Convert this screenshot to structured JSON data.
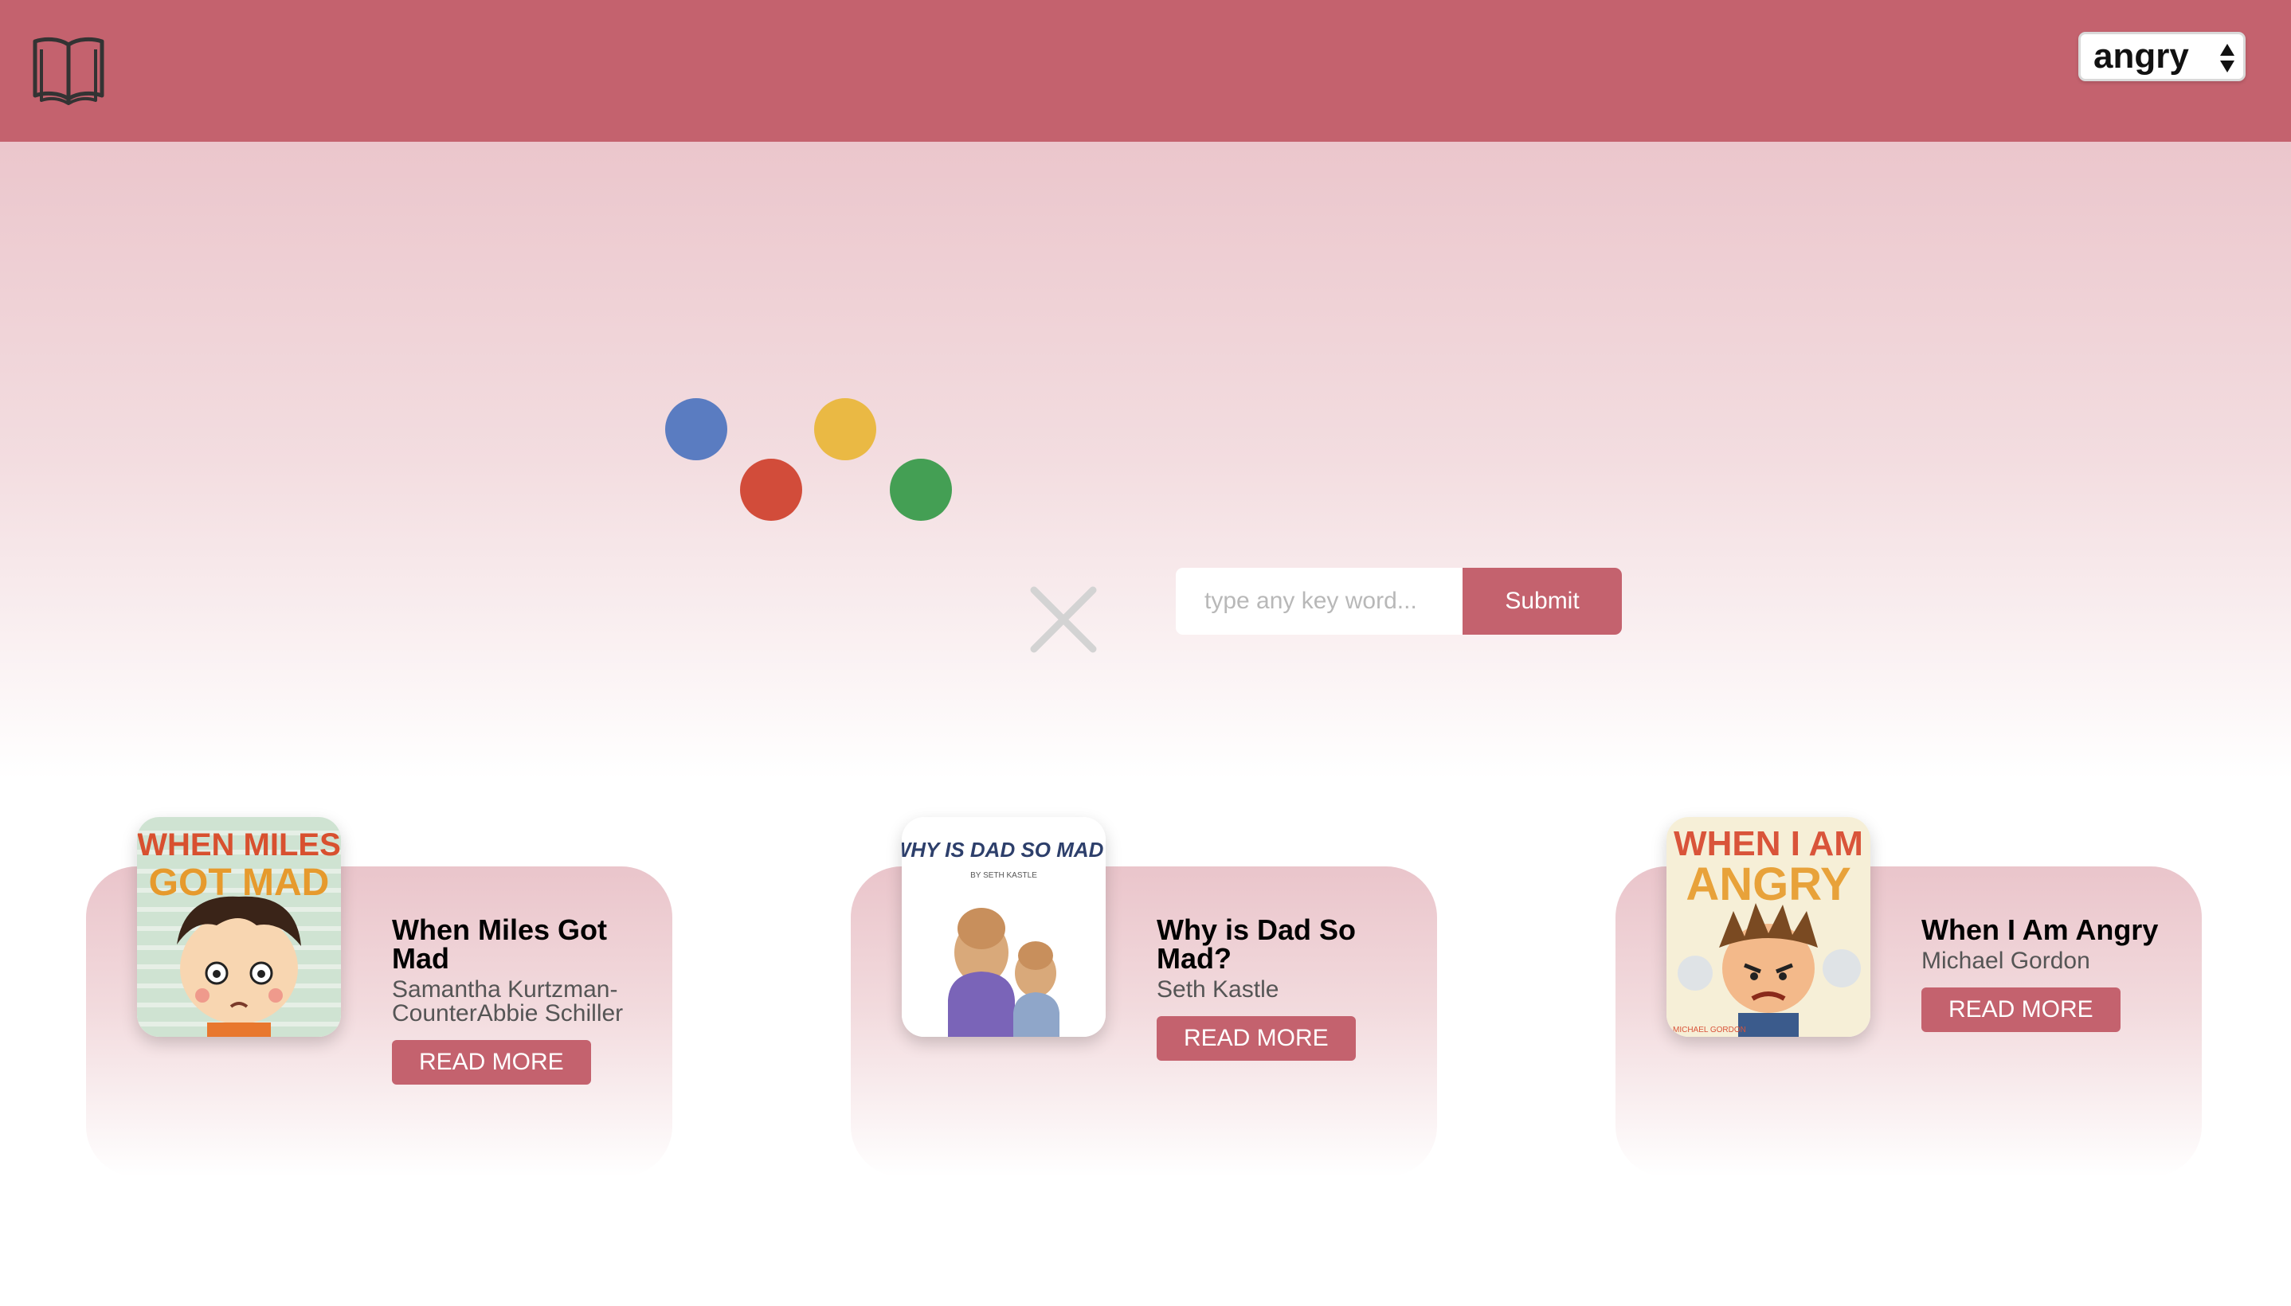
{
  "header": {
    "logo_icon": "open-book-icon",
    "mood_select": {
      "value": "angry",
      "icon": "up-down-arrows-icon"
    }
  },
  "hero": {
    "dots": [
      {
        "color": "#5a7cc1"
      },
      {
        "color": "#eab944"
      },
      {
        "color": "#d24c3a"
      },
      {
        "color": "#449f54"
      }
    ],
    "clear_icon": "close-icon",
    "search": {
      "placeholder": "type any key word...",
      "value": ""
    },
    "submit_label": "Submit"
  },
  "books": [
    {
      "title": "When Miles Got Mad",
      "author": "Samantha Kurtzman-CounterAbbie Schiller",
      "read_more_label": "READ MORE",
      "cover_text": [
        "WHEN MILES",
        "GOT MAD"
      ]
    },
    {
      "title": "Why is Dad So Mad?",
      "author": "Seth Kastle",
      "read_more_label": "READ MORE",
      "cover_text": [
        "WHY IS DAD SO MAD?",
        "BY SETH KASTLE"
      ]
    },
    {
      "title": "When I Am Angry",
      "author": "Michael Gordon",
      "read_more_label": "READ MORE",
      "cover_text": [
        "WHEN I AM",
        "ANGRY",
        "MICHAEL GORDON"
      ]
    }
  ],
  "colors": {
    "brand": "#c4626e",
    "hero_top": "#ebc6cc",
    "card_top": "#eac5cb"
  }
}
